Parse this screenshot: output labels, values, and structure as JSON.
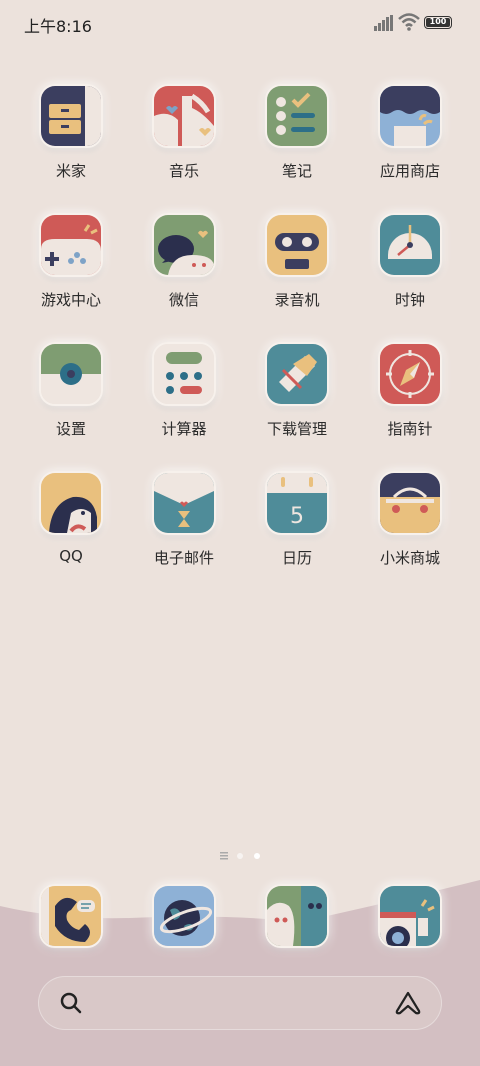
{
  "status": {
    "time": "上午8:16",
    "battery": "100"
  },
  "apps": [
    {
      "label": "米家",
      "icon": "mijia-icon"
    },
    {
      "label": "音乐",
      "icon": "music-icon"
    },
    {
      "label": "笔记",
      "icon": "notes-icon"
    },
    {
      "label": "应用商店",
      "icon": "app-store-icon"
    },
    {
      "label": "游戏中心",
      "icon": "game-center-icon"
    },
    {
      "label": "微信",
      "icon": "wechat-icon"
    },
    {
      "label": "录音机",
      "icon": "recorder-icon"
    },
    {
      "label": "时钟",
      "icon": "clock-icon"
    },
    {
      "label": "设置",
      "icon": "settings-icon"
    },
    {
      "label": "计算器",
      "icon": "calculator-icon"
    },
    {
      "label": "下载管理",
      "icon": "download-manager-icon"
    },
    {
      "label": "指南针",
      "icon": "compass-icon"
    },
    {
      "label": "QQ",
      "icon": "qq-icon"
    },
    {
      "label": "电子邮件",
      "icon": "email-icon"
    },
    {
      "label": "日历",
      "icon": "calendar-icon",
      "day": "5"
    },
    {
      "label": "小米商城",
      "icon": "mi-store-icon"
    }
  ],
  "dock": [
    {
      "icon": "phone-icon"
    },
    {
      "icon": "browser-icon"
    },
    {
      "icon": "messages-icon"
    },
    {
      "icon": "camera-icon"
    }
  ],
  "colors": {
    "background": "#ece2dc",
    "dock_wave": "#d3bfc2",
    "red": "#cf5a57",
    "teal": "#4f8c99",
    "green": "#7f9d72",
    "yellow": "#e9c07e",
    "navy": "#3b3e5f"
  }
}
